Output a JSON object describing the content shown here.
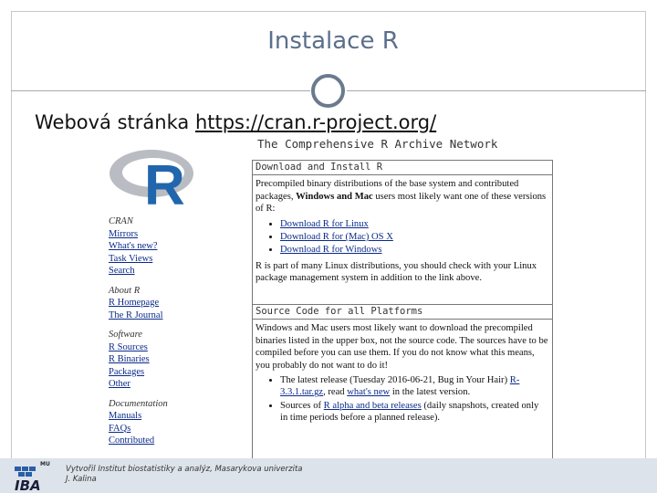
{
  "slide": {
    "title": "Instalace R",
    "subtitle_prefix": "Webová stránka ",
    "subtitle_link": "https://cran.r-project.org/"
  },
  "site": {
    "heading": "The Comprehensive R Archive Network",
    "logo_letter": "R",
    "nav": {
      "cran": {
        "head": "CRAN",
        "links": [
          "Mirrors",
          "What's new?",
          "Task Views",
          "Search"
        ]
      },
      "about": {
        "head": "About R",
        "links": [
          "R Homepage",
          "The R Journal"
        ]
      },
      "software": {
        "head": "Software",
        "links": [
          "R Sources",
          "R Binaries",
          "Packages",
          "Other"
        ]
      },
      "documentation": {
        "head": "Documentation",
        "links": [
          "Manuals",
          "FAQs",
          "Contributed"
        ]
      }
    },
    "download_box": {
      "head": "Download and Install R",
      "intro_part1": "Precompiled binary distributions of the base system and contributed packages, ",
      "intro_bold": "Windows and Mac",
      "intro_part2": " users most likely want one of these versions of R:",
      "links": [
        "Download R for Linux",
        "Download R for (Mac) OS X",
        "Download R for Windows"
      ],
      "footer_text": "R is part of many Linux distributions, you should check with your Linux package management system in addition to the link above."
    },
    "source_box": {
      "head": "Source Code for all Platforms",
      "intro": "Windows and Mac users most likely want to download the precompiled binaries listed in the upper box, not the source code. The sources have to be compiled before you can use them. If you do not know what this means, you probably do not want to do it!",
      "item1_prefix": "The latest release (Tuesday 2016-06-21, Bug in Your Hair) ",
      "item1_link1": "R-3.3.1.tar.gz",
      "item1_middle": ", read ",
      "item1_link2": "what's new",
      "item1_suffix": " in the latest version.",
      "item2_prefix": "Sources of ",
      "item2_link": "R alpha and beta releases",
      "item2_suffix": " (daily snapshots, created only in time periods before a planned release)."
    }
  },
  "footer": {
    "logo_text": "IBA",
    "logo_mark": "MU",
    "line1": "Vytvořil Institut biostatistiky a analýz, Masarykova univerzita",
    "line2": "J. Kalina"
  },
  "colors": {
    "title": "#5b6f8c",
    "link": "#0a2a8a",
    "footer_bg": "#dde3ea",
    "r_logo_blue": "#2166ac",
    "r_logo_grey": "#9a9da3"
  }
}
